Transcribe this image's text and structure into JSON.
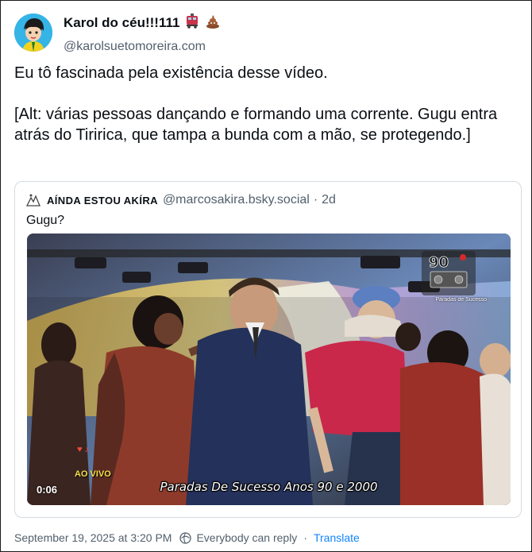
{
  "author": {
    "display_name": "Karol do céu!!!111",
    "handle": "@karolsuetomoreira.com",
    "emoji_icons": [
      "train-icon",
      "poop-icon"
    ]
  },
  "post": {
    "text": "Eu tô fascinada pela existência desse vídeo.\n\n[Alt: várias pessoas dançando e formando uma corrente. Gugu entra atrás do Tiririca, que tampa a bunda com a mão, se protegendo.]"
  },
  "quote": {
    "author_name": "AÍNDA ESTOU AKÍRA",
    "handle": "@marcosakira.bsky.social",
    "separator": "·",
    "time": "2d",
    "text": "Gugu?",
    "video": {
      "timestamp": "0:06",
      "caption": "Paradas De Sucesso Anos 90 e 2000",
      "overlay_label": "AO VIVO",
      "logo_text": "90's",
      "logo_subtitle": "Paradas de Sucesso"
    }
  },
  "footer": {
    "datetime": "September 19, 2025 at 3:20 PM",
    "reply_setting": "Everybody can reply",
    "separator": "·",
    "translate": "Translate"
  },
  "colors": {
    "link": "#1083fe",
    "muted": "#52606d",
    "border": "#d4dbe2"
  }
}
